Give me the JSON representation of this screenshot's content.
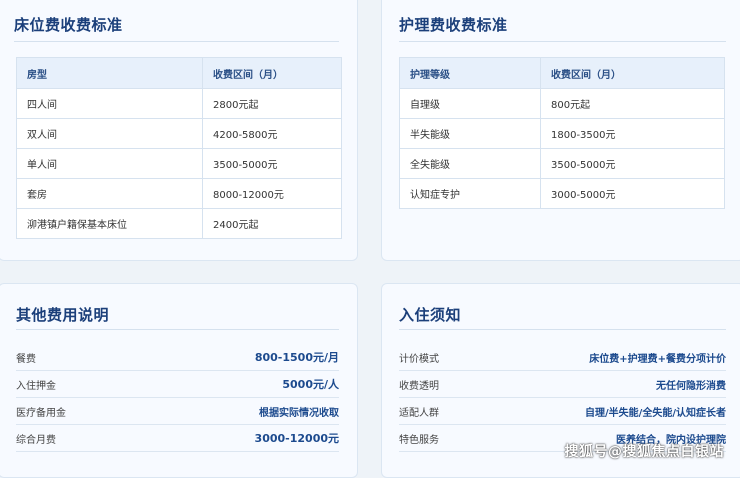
{
  "bed_card": {
    "title": "床位费收费标准",
    "headers": [
      "房型",
      "收费区间（月）"
    ],
    "rows": [
      [
        "四人间",
        "2800元起"
      ],
      [
        "双人间",
        "4200-5800元"
      ],
      [
        "单人间",
        "3500-5000元"
      ],
      [
        "套房",
        "8000-12000元"
      ],
      [
        "泖港镇户籍保基本床位",
        "2400元起"
      ]
    ]
  },
  "care_card": {
    "title": "护理费收费标准",
    "headers": [
      "护理等级",
      "收费区间（月）"
    ],
    "rows": [
      [
        "自理级",
        "800元起"
      ],
      [
        "半失能级",
        "1800-3500元"
      ],
      [
        "全失能级",
        "3500-5000元"
      ],
      [
        "认知症专护",
        "3000-5000元"
      ]
    ]
  },
  "other_card": {
    "title": "其他费用说明",
    "rows": [
      {
        "label": "餐费",
        "value": "800-1500元/月"
      },
      {
        "label": "入住押金",
        "value": "5000元/人"
      },
      {
        "label": "医疗备用金",
        "value": "根据实际情况收取"
      },
      {
        "label": "综合月费",
        "value": "3000-12000元"
      }
    ]
  },
  "notice_card": {
    "title": "入住须知",
    "rows": [
      {
        "label": "计价模式",
        "value": "床位费+护理费+餐费分项计价"
      },
      {
        "label": "收费透明",
        "value": "无任何隐形消费"
      },
      {
        "label": "适配人群",
        "value": "自理/半失能/全失能/认知症长者"
      },
      {
        "label": "特色服务",
        "value": "医养结合，院内设护理院"
      }
    ]
  },
  "watermark": "搜狐号@搜狐焦点白银站"
}
